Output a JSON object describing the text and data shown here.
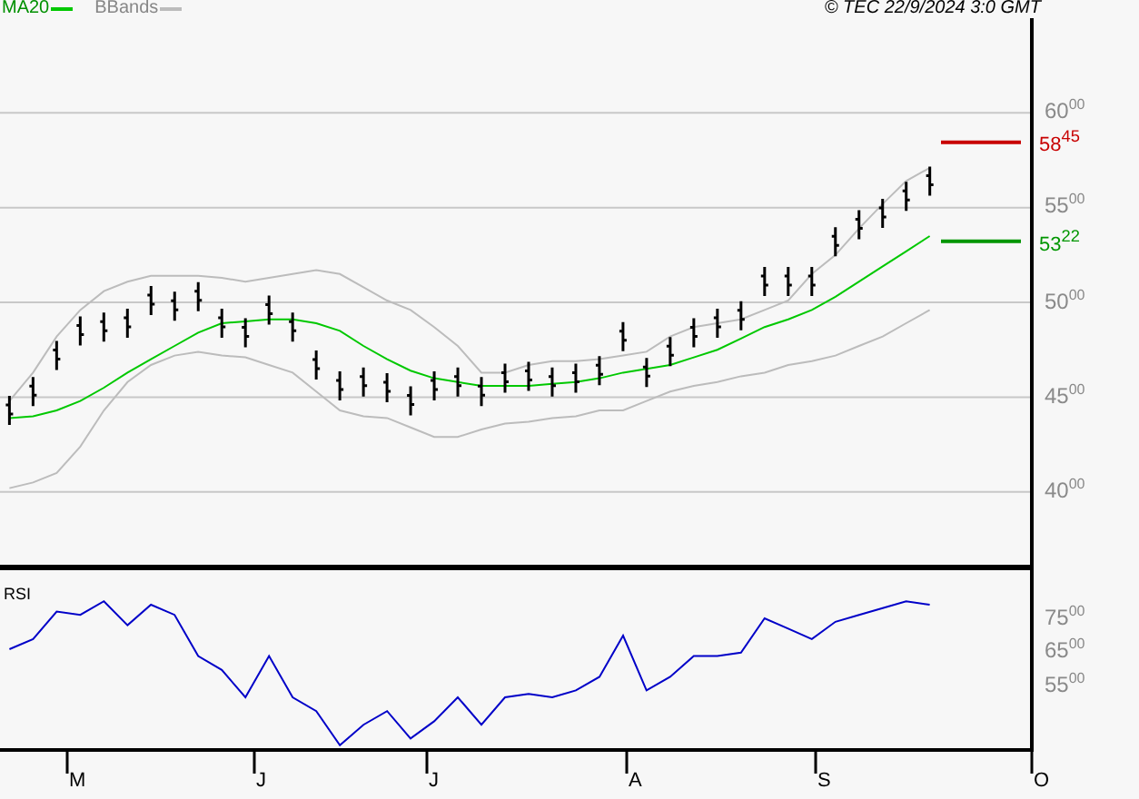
{
  "copyright": "© TEC 22/9/2024 3:0 GMT",
  "price_chart": {
    "levels": [
      {
        "label": "58$^{45}$",
        "color": "#c80000"
      },
      {
        "label": "53$^{22}$",
        "color": "#009600"
      }
    ],
    "chart_data": {
      "type": "line",
      "ylim": [
        3587,
        6500
      ],
      "grid": true,
      "yticks": [
        6000,
        5500,
        5000,
        4500,
        4000
      ],
      "series": [
        {
          "name": "MA20",
          "color": "#00c800",
          "values": [
            4390,
            4400,
            4430,
            4480,
            4550,
            4630,
            4700,
            4770,
            4840,
            4890,
            4900,
            4910,
            4910,
            4890,
            4850,
            4770,
            4700,
            4640,
            4600,
            4580,
            4560,
            4560,
            4560,
            4570,
            4580,
            4600,
            4630,
            4650,
            4670,
            4710,
            4750,
            4810,
            4870,
            4910,
            4960,
            5030,
            5110,
            5190,
            5270,
            5350
          ]
        },
        {
          "name": "BBands",
          "color": "#bcbcbc",
          "values": [
            4480,
            4630,
            4820,
            4960,
            5060,
            5110,
            5140,
            5140,
            5140,
            5130,
            5110,
            5130,
            5150,
            5170,
            5150,
            5080,
            5010,
            4960,
            4870,
            4770,
            4630,
            4630,
            4670,
            4690,
            4690,
            4700,
            4720,
            4740,
            4820,
            4870,
            4890,
            4910,
            4960,
            5010,
            5150,
            5250,
            5390,
            5520,
            5640,
            5710
          ]
        },
        {
          "color": "#bcbcbc",
          "values": [
            4020,
            4050,
            4100,
            4240,
            4430,
            4580,
            4670,
            4720,
            4740,
            4720,
            4710,
            4670,
            4630,
            4530,
            4430,
            4400,
            4390,
            4340,
            4290,
            4290,
            4330,
            4360,
            4370,
            4390,
            4400,
            4430,
            4430,
            4480,
            4530,
            4560,
            4580,
            4610,
            4630,
            4670,
            4690,
            4720,
            4770,
            4820,
            4890,
            4960
          ]
        }
      ]
    }
  },
  "rsi_chart": {
    "chart_data": {
      "type": "line",
      "ylim": [
        3612,
        8904
      ],
      "yticks": [
        7500,
        6500,
        5500
      ],
      "series": [
        {
          "name": "RSI",
          "color": "#0000c8",
          "values": [
            6600,
            6900,
            7700,
            7600,
            8000,
            7300,
            7900,
            7600,
            6400,
            6000,
            5200,
            6400,
            5200,
            4800,
            3800,
            4400,
            4800,
            4000,
            4500,
            5200,
            4400,
            5200,
            5300,
            5200,
            5400,
            5800,
            7000,
            5400,
            5800,
            6400,
            6400,
            6500,
            7500,
            7200,
            6900,
            7400,
            7600,
            7800,
            8000,
            7900
          ]
        }
      ]
    }
  },
  "months": [
    "M",
    "J",
    "J",
    "A",
    "S",
    "O"
  ]
}
